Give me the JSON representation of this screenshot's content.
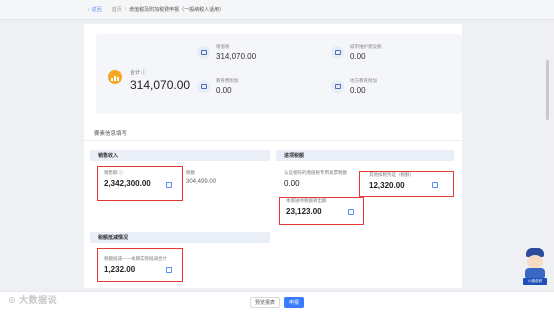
{
  "breadcrumb": {
    "back": "返回",
    "home": "首页",
    "current": "增值税及附加税费申报（一般纳税人适用）"
  },
  "summary": {
    "total_label": "合计",
    "total_value": "314,070.00",
    "items": [
      {
        "label": "增值税",
        "value": "314,070.00"
      },
      {
        "label": "城市维护建设税",
        "value": "0.00"
      },
      {
        "label": "教育费附加",
        "value": "0.00"
      },
      {
        "label": "地方教育附加",
        "value": "0.00"
      }
    ]
  },
  "section_title": "要素信息填写",
  "groups": {
    "sales": {
      "header": "销售收入",
      "fields": [
        {
          "label": "销售额",
          "value": "2,342,300.00"
        },
        {
          "label": "税额",
          "value": "304,499.00"
        }
      ]
    },
    "input": {
      "header": "进项税额",
      "fields": [
        {
          "label": "认证相符的增值税专用发票税额",
          "value": "0.00"
        },
        {
          "label": "其他扣税凭证（税额）",
          "value": "12,320.00"
        },
        {
          "label": "本期进项税额转出额",
          "value": "23,123.00"
        }
      ]
    },
    "reduction": {
      "header": "税额抵减情况",
      "fields": [
        {
          "label": "税额抵减——本期实际抵减合计",
          "value": "1,232.00"
        }
      ]
    }
  },
  "buttons": {
    "secondary": "预览报表",
    "primary": "申报"
  },
  "watermark": "大数据说",
  "mascot_label": "小康说税"
}
